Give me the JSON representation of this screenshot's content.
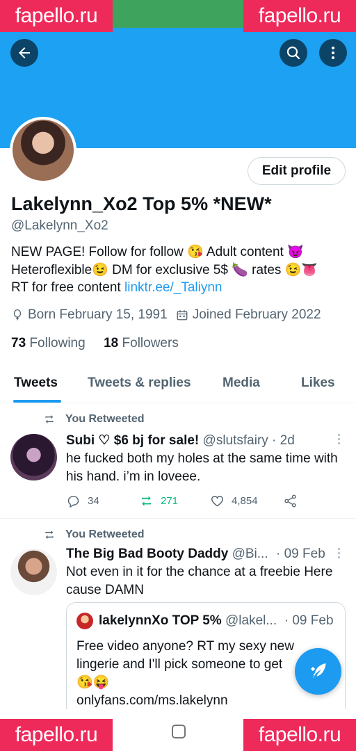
{
  "watermark": {
    "text": "fapello.ru"
  },
  "profile": {
    "display_name": "Lakelynn_Xo2 Top 5% *NEW*",
    "handle": "@Lakelynn_Xo2",
    "edit_button": "Edit profile",
    "bio_line1": "NEW PAGE!   Follow for follow 😘 Adult content 😈",
    "bio_line2": "Heteroflexible😉 DM for exclusive 5$ 🍆 rates 😉👅",
    "bio_line3": "RT for free content ",
    "bio_link": "linktr.ee/_Taliynn",
    "born": "Born February 15, 1991",
    "joined": "Joined February 2022",
    "following_count": "73",
    "following_label": "Following",
    "followers_count": "18",
    "followers_label": "Followers"
  },
  "tabs": [
    "Tweets",
    "Tweets & replies",
    "Media",
    "Likes"
  ],
  "tweets": [
    {
      "retweet_label": "You Retweeted",
      "name": "Subi ♡ $6 bj for sale!",
      "handle_time": " @slutsfairy · 2d",
      "text": "he fucked both my holes at the same time with his hand. i’m in loveee.",
      "replies": "34",
      "retweets": "271",
      "likes": "4,854"
    },
    {
      "retweet_label": "You Retweeted",
      "name": "The Big Bad Booty Daddy",
      "handle": " @Bi...",
      "time": "· 09 Feb",
      "text": "Not even in it for the chance at a freebie Here cause DAMN",
      "quote": {
        "name": "lakelynnXo TOP 5%",
        "handle_time": " @lakel...  · 09 Feb",
        "text_line1": "Free video anyone? RT my sexy new",
        "text_line2": "lingerie and I'll pick someone to get",
        "text_line3": "😘😝",
        "text_line4": "onlyfans.com/ms.lakelynn"
      }
    }
  ],
  "colors": {
    "header": "#1da1f2",
    "accent": "#1d9bf0",
    "retweet": "#00ba7c",
    "watermark": "#ee2a5b"
  },
  "icons": [
    "back-arrow-icon",
    "search-icon",
    "more-vertical-icon",
    "balloon-icon",
    "calendar-icon",
    "retweet-icon",
    "reply-icon",
    "like-icon",
    "share-icon",
    "compose-icon"
  ]
}
